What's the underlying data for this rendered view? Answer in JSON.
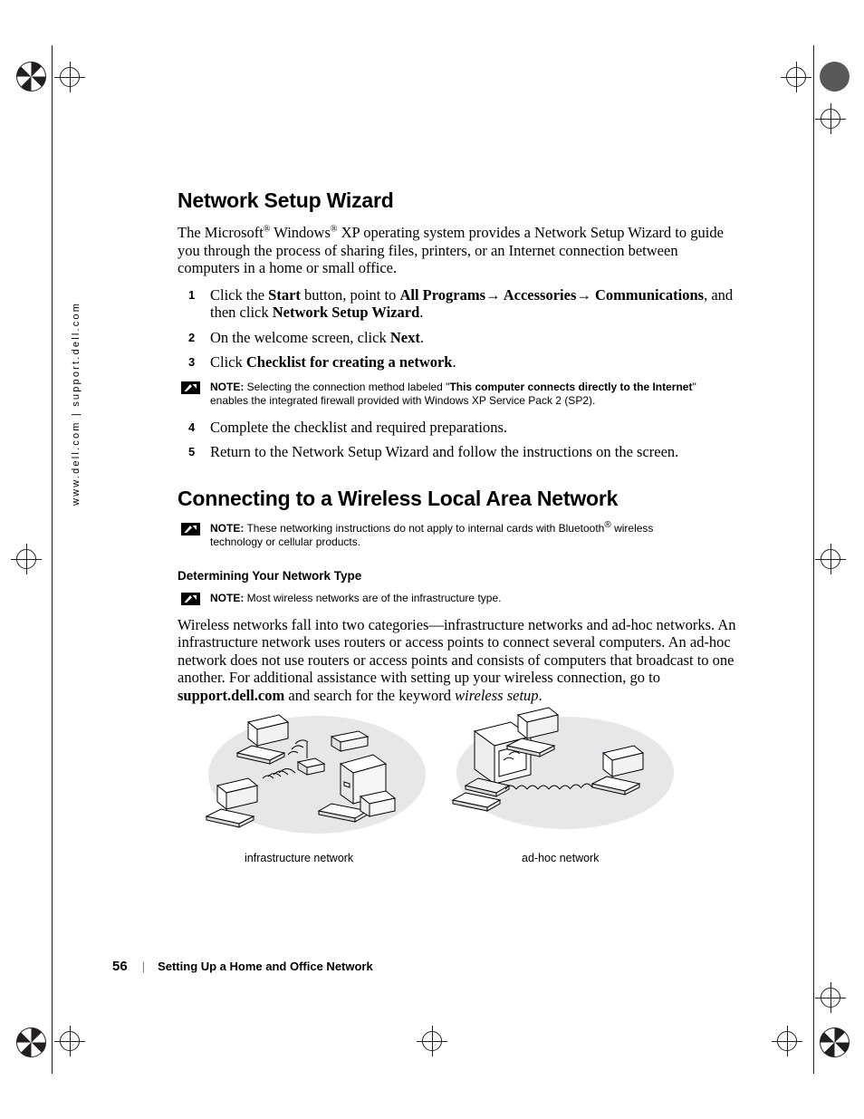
{
  "side_url": "www.dell.com | support.dell.com",
  "headings": {
    "h1_network_setup_wizard": "Network Setup Wizard",
    "h1_connecting_wireless": "Connecting to a Wireless Local Area Network",
    "h2_determining_type": "Determining Your Network Type"
  },
  "intro": {
    "part1": "The Microsoft",
    "sup1": "®",
    "part2": " Windows",
    "sup2": "®",
    "part3": " XP operating system provides a Network Setup Wizard to guide you through the process of sharing files, printers, or an Internet connection between computers in a home or small office."
  },
  "steps": [
    {
      "num": "1",
      "segments": [
        {
          "text": "Click the ",
          "style": "normal"
        },
        {
          "text": "Start",
          "style": "bold"
        },
        {
          "text": " button, point to ",
          "style": "normal"
        },
        {
          "text": "All Programs",
          "style": "bold"
        },
        {
          "text": "→",
          "style": "arrow"
        },
        {
          "text": " Accessories",
          "style": "bold"
        },
        {
          "text": "→",
          "style": "arrow"
        },
        {
          "text": " Communications",
          "style": "bold"
        },
        {
          "text": ", and then click ",
          "style": "normal"
        },
        {
          "text": "Network Setup Wizard",
          "style": "bold"
        },
        {
          "text": ".",
          "style": "normal"
        }
      ]
    },
    {
      "num": "2",
      "segments": [
        {
          "text": "On the welcome screen, click ",
          "style": "normal"
        },
        {
          "text": "Next",
          "style": "bold"
        },
        {
          "text": ".",
          "style": "normal"
        }
      ]
    },
    {
      "num": "3",
      "segments": [
        {
          "text": "Click ",
          "style": "normal"
        },
        {
          "text": "Checklist for creating a network",
          "style": "bold"
        },
        {
          "text": ".",
          "style": "normal"
        }
      ]
    },
    {
      "num": "4",
      "segments": [
        {
          "text": "Complete the checklist and required preparations.",
          "style": "normal"
        }
      ]
    },
    {
      "num": "5",
      "segments": [
        {
          "text": "Return to the Network Setup Wizard and follow the instructions on the screen.",
          "style": "normal"
        }
      ]
    }
  ],
  "notes": {
    "note_label": "NOTE:",
    "note1_line1_a": " Selecting the connection method labeled \"",
    "note1_line1_b": "This computer connects directly to the Internet",
    "note1_line1_c": "\"",
    "note1_line2": "enables the integrated firewall provided with Windows XP Service Pack 2 (SP2).",
    "note2_a": " These networking instructions do not apply to internal cards with Bluetooth",
    "note2_sup": "®",
    "note2_b": " wireless",
    "note2_line2": "technology or cellular products.",
    "note3": " Most wireless networks are of the infrastructure type."
  },
  "wireless_paragraph": {
    "part1": "Wireless networks fall into two categories—infrastructure networks and ad-hoc networks. An infrastructure network uses routers or access points to connect several computers. An ad-hoc network does not use routers or access points and consists of computers that broadcast to one another. For additional assistance with setting up your wireless connection, go to ",
    "bold1": "support.dell.com",
    "part2": " and search for the keyword ",
    "ital1": "wireless setup",
    "part3": "."
  },
  "figure": {
    "caption_left": "infrastructure network",
    "caption_right": "ad-hoc network"
  },
  "footer": {
    "page_number": "56",
    "separator": "|",
    "title": "Setting Up a Home and Office Network"
  },
  "colors": {
    "ink": "#000000",
    "registration": "#231f20",
    "figure_fill": "#e6e7e8",
    "gray_text": "#808080"
  }
}
